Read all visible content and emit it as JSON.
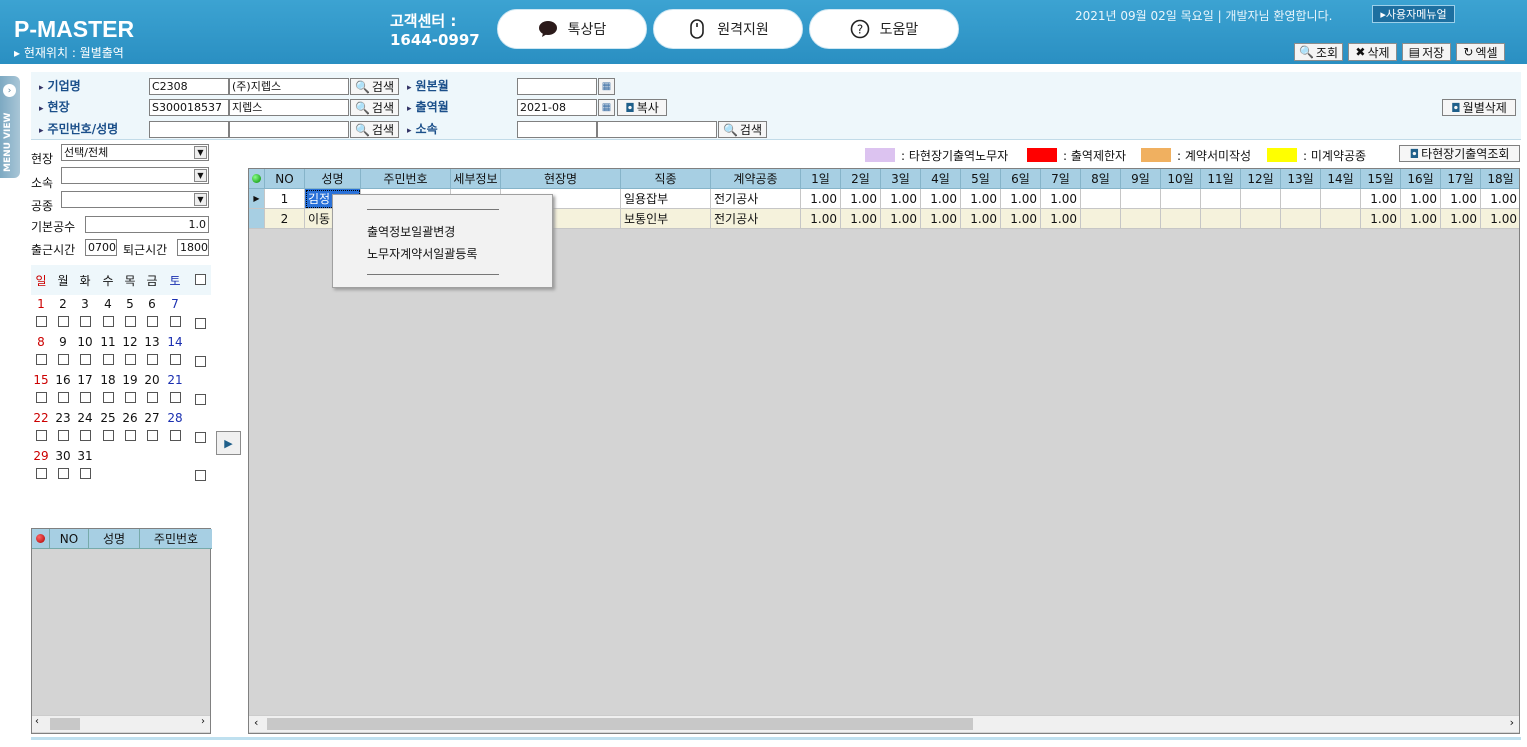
{
  "header": {
    "logo": "P-MASTER",
    "location": "▸ 현재위치 : 월별출역",
    "cs_title": "고객센터 :",
    "cs_phone": "1644-0997",
    "pills": [
      {
        "label": "톡상담",
        "icon": "chat-bubble-icon"
      },
      {
        "label": "원격지원",
        "icon": "mouse-icon"
      },
      {
        "label": "도움말",
        "icon": "question-icon"
      }
    ],
    "welcome": "2021년 09월 02일 목요일 | 개발자님 환영합니다.",
    "user_menu": "▸사용자메뉴얼",
    "toolbar": {
      "search": "조회",
      "delete": "삭제",
      "save": "저장",
      "excel": "엑셀"
    }
  },
  "menu_view_label": "MENU VIEW",
  "search": {
    "company_label": "기업명",
    "company_code": "C2308",
    "company_name": "(주)지렙스",
    "site_label": "현장",
    "site_code": "S300018537",
    "site_name": "지렙스",
    "person_label": "주민번호/성명",
    "person_id": "",
    "person_name": "",
    "search_btn": "검색",
    "origin_month_label": "원본월",
    "origin_month": "",
    "work_month_label": "출역월",
    "work_month": "2021-08",
    "copy_btn": "복사",
    "affil_label": "소속",
    "affil_code": "",
    "affil_name": "",
    "monthly_delete_btn": "월별삭제"
  },
  "left": {
    "site_label": "현장",
    "site_value": "선택/전체",
    "affil_label": "소속",
    "trade_label": "공종",
    "base_label": "기본공수",
    "base_value": "1.0",
    "in_label": "출근시간",
    "in_value": "0700",
    "out_label": "퇴근시간",
    "out_value": "1800",
    "weekdays": [
      "일",
      "월",
      "화",
      "수",
      "목",
      "금",
      "토"
    ],
    "weeks": [
      [
        "1",
        "2",
        "3",
        "4",
        "5",
        "6",
        "7"
      ],
      [
        "8",
        "9",
        "10",
        "11",
        "12",
        "13",
        "14"
      ],
      [
        "15",
        "16",
        "17",
        "18",
        "19",
        "20",
        "21"
      ],
      [
        "22",
        "23",
        "24",
        "25",
        "26",
        "27",
        "28"
      ],
      [
        "29",
        "30",
        "31"
      ]
    ],
    "grid_headers": [
      "NO",
      "성명",
      "주민번호"
    ]
  },
  "legend": {
    "other_site": ": 타현장기출역노무자",
    "restricted": ": 출역제한자",
    "no_contract": ": 계약서미작성",
    "no_trade": ": 미계약공종",
    "btn": "타현장기출역조회",
    "colors": {
      "other_site": "#dcc3f0",
      "restricted": "#ff0000",
      "no_contract": "#f0b060",
      "no_trade": "#ffff00"
    }
  },
  "grid": {
    "headers": [
      "NO",
      "성명",
      "주민번호",
      "세부정보",
      "현장명",
      "직종",
      "계약공종",
      "1일",
      "2일",
      "3일",
      "4일",
      "5일",
      "6일",
      "7일",
      "8일",
      "9일",
      "10일",
      "11일",
      "12일",
      "13일",
      "14일",
      "15일",
      "16일",
      "17일",
      "18일"
    ],
    "rows": [
      {
        "no": "1",
        "name": "김정",
        "jumin": "",
        "detail": "",
        "site": "",
        "job": "일용잡부",
        "trade": "전기공사",
        "days": [
          "1.00",
          "1.00",
          "1.00",
          "1.00",
          "1.00",
          "1.00",
          "1.00",
          "",
          "",
          "",
          "",
          "",
          "",
          "",
          "1.00",
          "1.00",
          "1.00",
          "1.00"
        ]
      },
      {
        "no": "2",
        "name": "이동",
        "jumin": "",
        "detail": "",
        "site": "",
        "job": "보통인부",
        "trade": "전기공사",
        "days": [
          "1.00",
          "1.00",
          "1.00",
          "1.00",
          "1.00",
          "1.00",
          "1.00",
          "",
          "",
          "",
          "",
          "",
          "",
          "",
          "1.00",
          "1.00",
          "1.00",
          "1.00"
        ]
      }
    ]
  },
  "context_menu": {
    "item1": "출역정보일괄변경",
    "item2": "노무자계약서일괄등록"
  }
}
